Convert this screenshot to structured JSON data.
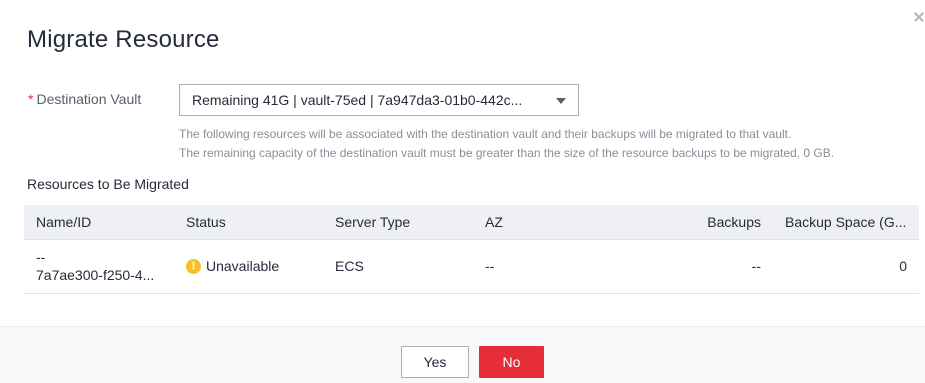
{
  "dialog": {
    "title": "Migrate Resource",
    "close_icon": "close-icon"
  },
  "destination": {
    "required_mark": "*",
    "label": "Destination Vault",
    "selected_value": "Remaining 41G | vault-75ed | 7a947da3-01b0-442c...",
    "caret_icon": "caret-down-icon",
    "hint_line1": "The following resources will be associated with the destination vault and their backups will be migrated to that vault.",
    "hint_line2": "The remaining capacity of the destination vault must be greater than the size of the resource backups to be migrated, 0 GB."
  },
  "resources": {
    "section_title": "Resources to Be Migrated",
    "columns": [
      "Name/ID",
      "Status",
      "Server Type",
      "AZ",
      "Backups",
      "Backup Space (G..."
    ],
    "rows": [
      {
        "name": "--",
        "id": "7a7ae300-f250-4...",
        "status": "Unavailable",
        "status_icon": "warning-icon",
        "status_color": "#f5c02c",
        "server_type": "ECS",
        "az": "--",
        "backups": "--",
        "backup_space": "0"
      }
    ]
  },
  "footer": {
    "yes_label": "Yes",
    "no_label": "No",
    "primary_color": "#e62e3a"
  }
}
